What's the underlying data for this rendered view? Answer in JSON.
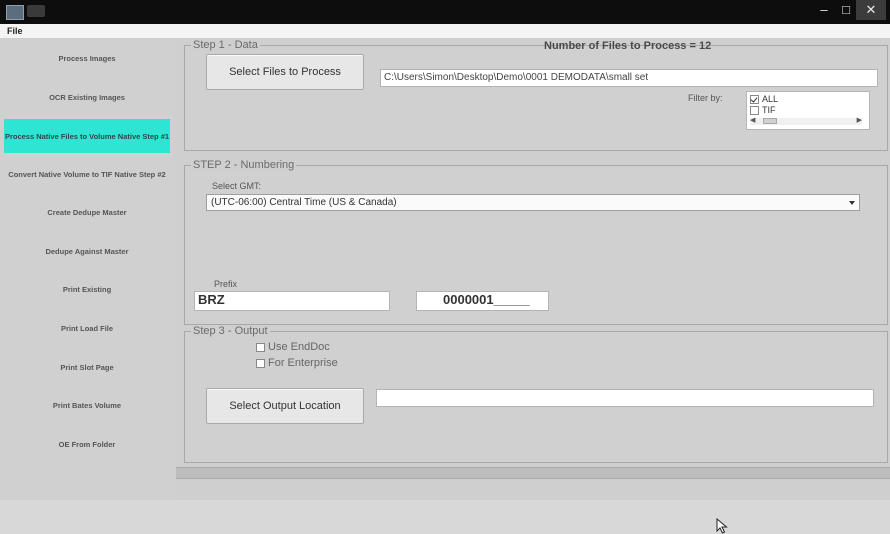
{
  "menu": {
    "file": "File"
  },
  "sidebar": {
    "items": [
      {
        "label": "Process Images"
      },
      {
        "label": "OCR Existing Images"
      },
      {
        "label": "Process Native Files to Volume Native Step #1"
      },
      {
        "label": "Convert Native Volume to TIF Native Step #2"
      },
      {
        "label": "Create Dedupe Master"
      },
      {
        "label": "Dedupe Against Master"
      },
      {
        "label": "Print Existing"
      },
      {
        "label": "Print Load File"
      },
      {
        "label": "Print Slot Page"
      },
      {
        "label": "Print Bates Volume"
      },
      {
        "label": "OE From Folder"
      }
    ]
  },
  "step1": {
    "title": "Step 1 - Data",
    "files_count_label": "Number of Files to Process = 12",
    "select_files_button": "Select Files to Process",
    "path_value": "C:\\Users\\Simon\\Desktop\\Demo\\0001 DEMODATA\\small set",
    "filter_label": "Filter by:",
    "filter_options": [
      {
        "label": "ALL",
        "checked": true
      },
      {
        "label": "TIF",
        "checked": false
      }
    ]
  },
  "step2": {
    "title": "STEP 2 - Numbering",
    "timezone_label": "Select GMT:",
    "timezone_value": "(UTC-06:00) Central Time (US & Canada)",
    "prefix_label": "Prefix",
    "prefix_value": "BRZ",
    "number_value": "0000001_____"
  },
  "step3": {
    "title": "Step 3 - Output",
    "use_enddoc": "Use EndDoc",
    "for_enterprise": "For Enterprise",
    "select_output_button": "Select Output Location",
    "output_value": ""
  },
  "colors": {
    "active_nav": "#2ee5d4",
    "window_background": "#d0d0d0",
    "title_bar": "#0d0d0d"
  }
}
